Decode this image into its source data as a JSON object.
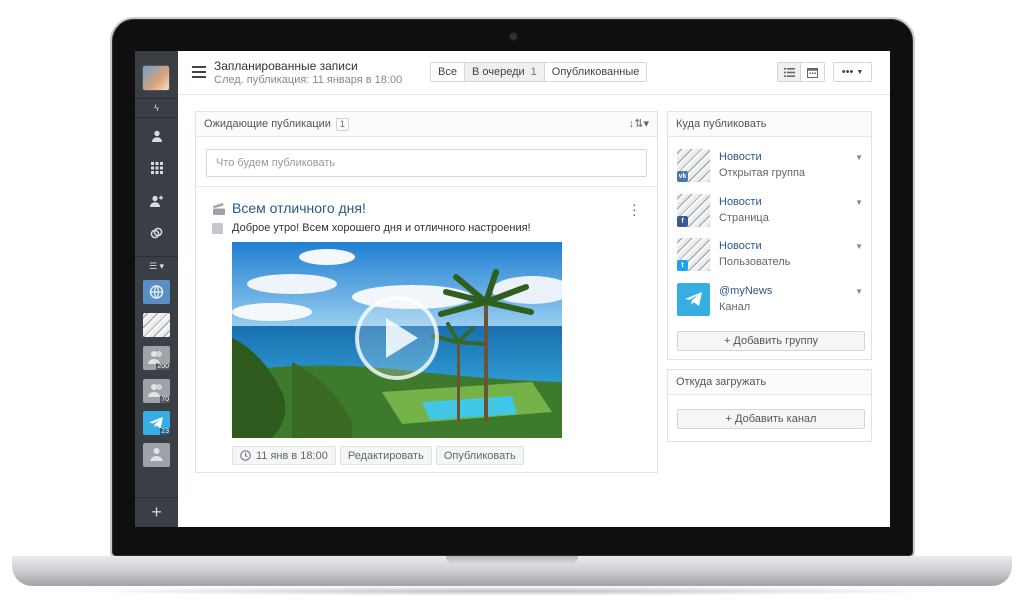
{
  "header": {
    "title": "Запланированные записи",
    "subtitle": "След. публикация: 11 января в 18:00"
  },
  "tabs": [
    {
      "label": "Все",
      "count": ""
    },
    {
      "label": "В очереди",
      "count": "1"
    },
    {
      "label": "Опубликованные",
      "count": ""
    }
  ],
  "pending": {
    "title": "Ожидающие публикации",
    "count": "1",
    "compose_placeholder": "Что будем публиковать"
  },
  "post": {
    "title": "Всем отличного дня!",
    "text": "Доброе утро! Всем хорошего дня и отличного настроения!",
    "time_label": "11 янв в 18:00",
    "edit_label": "Редактировать",
    "publish_label": "Опубликовать"
  },
  "publish_to": {
    "title": "Куда публиковать",
    "destinations": [
      {
        "name": "Новости",
        "type": "Открытая группа",
        "network": "vk",
        "network_color": "#4a76a8"
      },
      {
        "name": "Новости",
        "type": "Страница",
        "network": "facebook",
        "network_color": "#3b5998"
      },
      {
        "name": "Новости",
        "type": "Пользователь",
        "network": "twitter",
        "network_color": "#1da1f2"
      },
      {
        "name": "@myNews",
        "type": "Канал",
        "network": "telegram",
        "network_color": "#37aee2"
      }
    ],
    "add_label": "+ Добавить группу"
  },
  "load_from": {
    "title": "Откуда загружать",
    "add_label": "+ Добавить канал"
  },
  "sidebar": {
    "badges": [
      "200",
      "70",
      "23"
    ]
  },
  "colors": {
    "link": "#2a5885",
    "sidebar": "#3a3e45"
  }
}
